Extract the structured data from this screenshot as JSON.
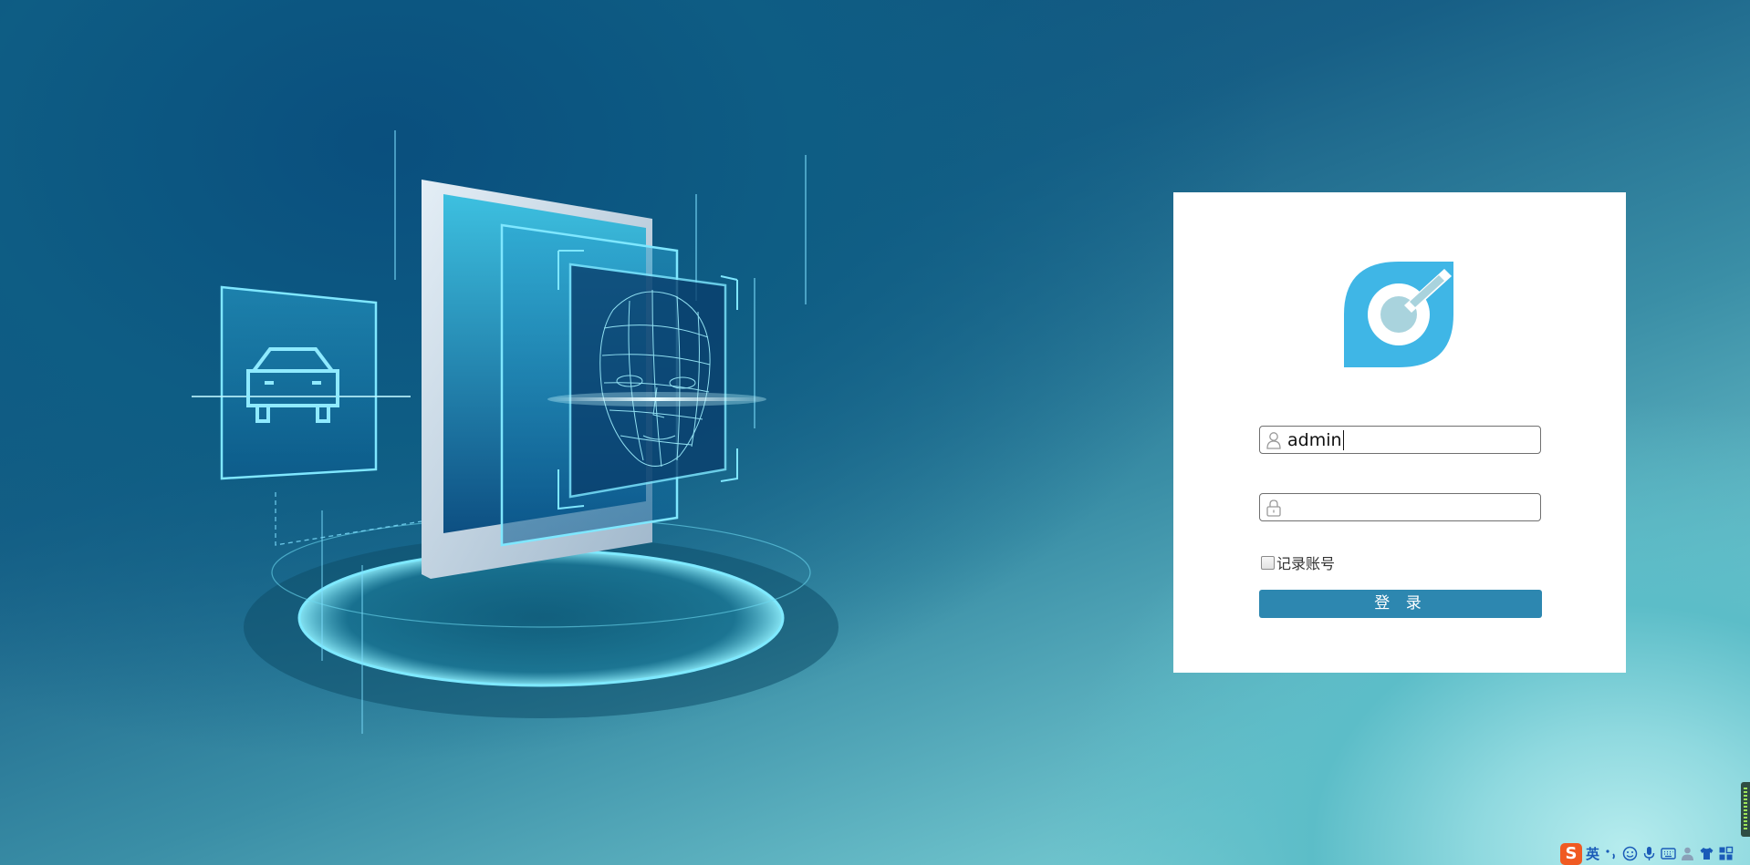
{
  "login": {
    "username_value": "admin",
    "password_value": "",
    "remember_label": "记录账号",
    "remember_checked": false,
    "login_button": "登 录"
  },
  "ime": {
    "logo_text": "S",
    "language": "英",
    "icons": [
      "punctuation-icon",
      "emoji-icon",
      "microphone-icon",
      "keyboard-icon",
      "user-icon",
      "skin-icon",
      "toolbox-icon"
    ]
  },
  "colors": {
    "accent": "#2d87b0",
    "logo": "#3fb6e6",
    "card": "#ffffff"
  }
}
